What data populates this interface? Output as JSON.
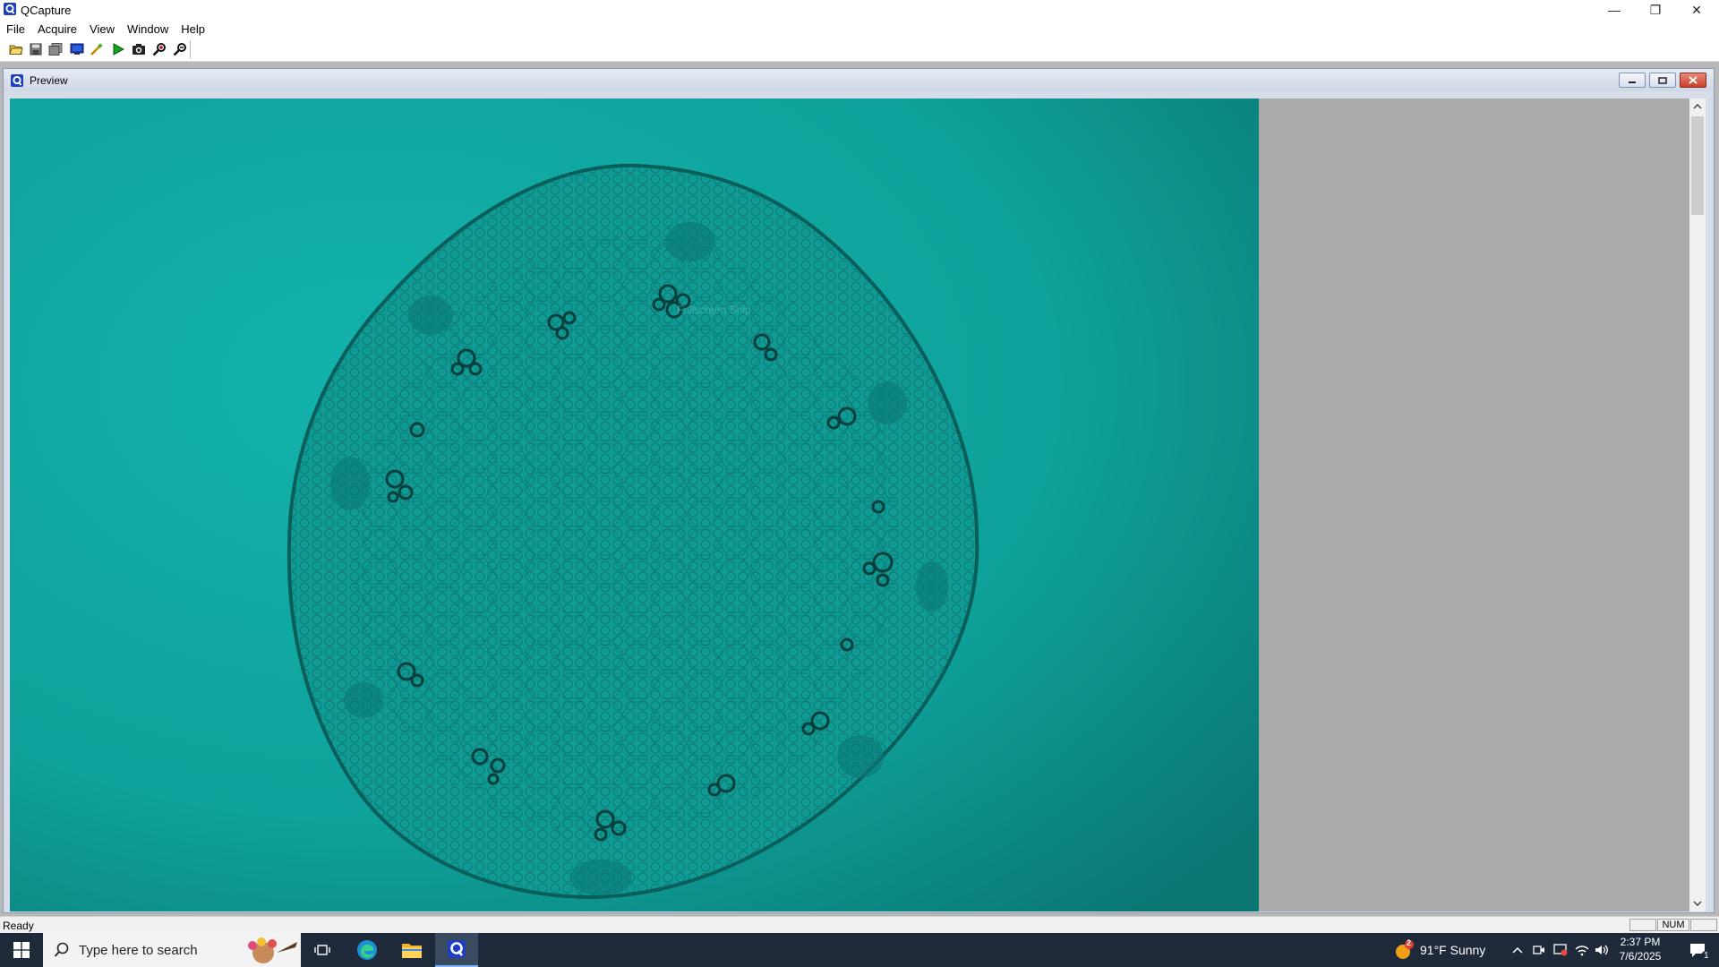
{
  "window": {
    "title": "QCapture",
    "controls": {
      "minimize": "—",
      "restore": "❐",
      "close": "✕"
    }
  },
  "menu": [
    {
      "label": "File"
    },
    {
      "label": "Acquire"
    },
    {
      "label": "View"
    },
    {
      "label": "Window"
    },
    {
      "label": "Help"
    }
  ],
  "toolbar": {
    "tools": [
      "open-folder-icon",
      "save-icon",
      "save-multiple-icon",
      "monitor-icon",
      "wand-icon",
      "play-icon",
      "camera-icon",
      "zoom-in-icon",
      "zoom-out-icon"
    ]
  },
  "preview_window": {
    "title": "Preview",
    "overlay_text": "Fullscreen Snip"
  },
  "statusbar": {
    "status": "Ready",
    "panes": [
      "",
      "NUM",
      ""
    ]
  },
  "taskbar": {
    "search_placeholder": "Type here to search",
    "weather_badge": "2",
    "weather": "91°F  Sunny",
    "time": "2:37 PM",
    "date": "7/6/2025",
    "notification_count": "1",
    "colors": {
      "background": "#1e2a3a",
      "accent": "#7fb3ff"
    }
  },
  "colors": {
    "specimen_bg": "#0f9e98",
    "specimen_dark": "#0b6f6b",
    "empty_area": "#aaaaaa"
  }
}
